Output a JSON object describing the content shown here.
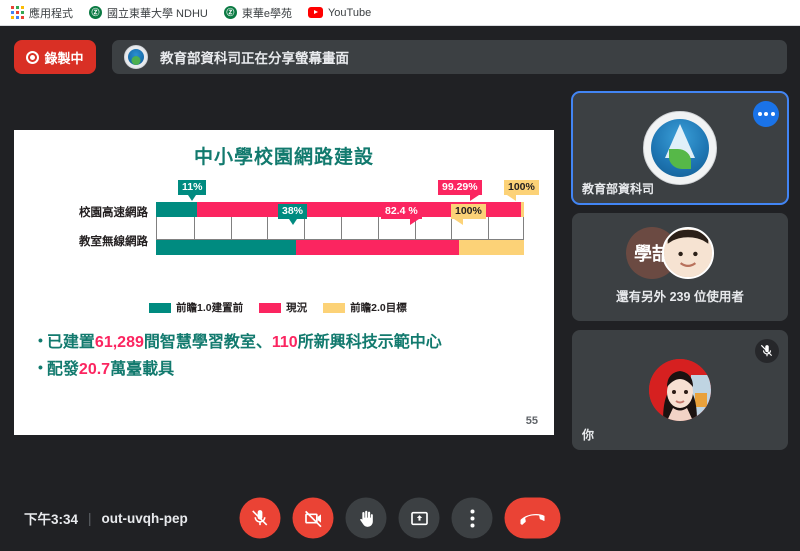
{
  "browser": {
    "bookmarks": [
      {
        "label": "應用程式",
        "icon": "apps-grid-icon"
      },
      {
        "label": "國立東華大學 NDHU",
        "icon": "ndhu-badge-icon"
      },
      {
        "label": "東華e學苑",
        "icon": "ndhu-badge-icon"
      },
      {
        "label": "YouTube",
        "icon": "youtube-icon"
      }
    ]
  },
  "topbar": {
    "recording_label": "錄製中",
    "recording_icon": "record-dot-icon",
    "share_notice": "教育部資科司正在分享螢幕畫面",
    "share_avatar_icon": "ministry-of-education-logo-icon"
  },
  "slide": {
    "title": "中小學校園網路建設",
    "page_number": "55",
    "chart_data": {
      "type": "bar",
      "title": "中小學校園網路建設",
      "orientation": "horizontal",
      "categories": [
        "校園高速網路",
        "教室無線網路"
      ],
      "xlabel": "",
      "ylabel": "",
      "xlim": [
        0,
        110
      ],
      "grid": true,
      "grid_interval": 10,
      "legend_position": "bottom",
      "series": [
        {
          "name": "前瞻1.0建置前",
          "color": "#008b80",
          "values": [
            11,
            38
          ],
          "labels": [
            "11%",
            "38%"
          ]
        },
        {
          "name": "現況",
          "color": "#fb2560",
          "values": [
            99.29,
            82.4
          ],
          "labels": [
            "99.29%",
            "82.4 %"
          ]
        },
        {
          "name": "前瞻2.0目標",
          "color": "#fcd277",
          "values": [
            100,
            100
          ],
          "labels": [
            "100%",
            "100%"
          ]
        }
      ]
    },
    "legend": [
      {
        "label": "前瞻1.0建置前",
        "color": "#008b80"
      },
      {
        "label": "現況",
        "color": "#fb2560"
      },
      {
        "label": "前瞻2.0目標",
        "color": "#fcd277"
      }
    ],
    "bullets": [
      {
        "pre": "已建置",
        "num1": "61,289",
        "mid": "間智慧學習教室、",
        "num2": "110",
        "post": "所新興科技示範中心"
      },
      {
        "pre": "配發",
        "num1": "20.7",
        "mid": "萬臺載具",
        "num2": "",
        "post": ""
      }
    ],
    "photos": [
      {
        "caption": "smart-classroom-photo"
      },
      {
        "caption": "students-drone-photo"
      }
    ]
  },
  "rail": {
    "tiles": [
      {
        "name": "教育部資科司",
        "icon": "ministry-of-education-logo-icon",
        "more_icon": "more-options-icon",
        "active": true
      },
      {
        "name": "還有另外 239 位使用者",
        "initials": "學喆",
        "icon": "participants-overflow-icon"
      },
      {
        "name": "你",
        "mute_icon": "mic-off-icon"
      }
    ]
  },
  "bottombar": {
    "time": "下午3:34",
    "separator": "|",
    "meeting_code": "out-uvqh-pep",
    "controls": [
      {
        "name": "mic-off-button",
        "icon": "mic-off-icon",
        "state": "muted"
      },
      {
        "name": "camera-off-button",
        "icon": "camera-off-icon",
        "state": "off"
      },
      {
        "name": "raise-hand-button",
        "icon": "raise-hand-icon",
        "state": "default"
      },
      {
        "name": "present-screen-button",
        "icon": "present-screen-icon",
        "state": "default"
      },
      {
        "name": "more-options-button",
        "icon": "more-vertical-icon",
        "state": "default"
      },
      {
        "name": "end-call-button",
        "icon": "hangup-icon",
        "state": "danger"
      }
    ]
  }
}
